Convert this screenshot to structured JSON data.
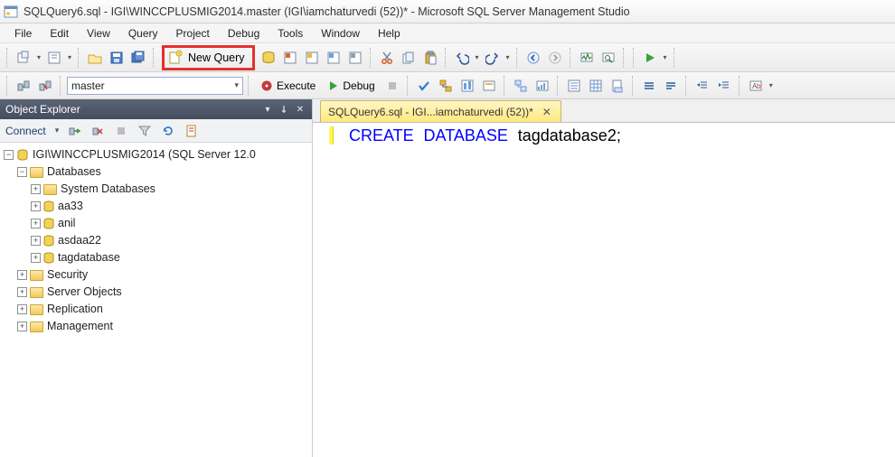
{
  "title": "SQLQuery6.sql - IGI\\WINCCPLUSMIG2014.master (IGI\\iamchaturvedi (52))* - Microsoft SQL Server Management Studio",
  "menu": [
    "File",
    "Edit",
    "View",
    "Query",
    "Project",
    "Debug",
    "Tools",
    "Window",
    "Help"
  ],
  "toolbar": {
    "newquery_label": "New Query",
    "execute_label": "Execute",
    "debug_label": "Debug",
    "db_selected": "master"
  },
  "object_explorer": {
    "title": "Object Explorer",
    "connect_label": "Connect",
    "root": "IGI\\WINCCPLUSMIG2014 (SQL Server 12.0",
    "databases_label": "Databases",
    "sysdb_label": "System Databases",
    "dbs": [
      "aa33",
      "anil",
      "asdaa22",
      "tagdatabase"
    ],
    "folders": [
      "Security",
      "Server Objects",
      "Replication",
      "Management"
    ]
  },
  "editor_tab": "SQLQuery6.sql - IGI...iamchaturvedi (52))*",
  "code": {
    "kw1": "CREATE",
    "kw2": "DATABASE",
    "ident": "tagdatabase2",
    "semi": ";"
  }
}
